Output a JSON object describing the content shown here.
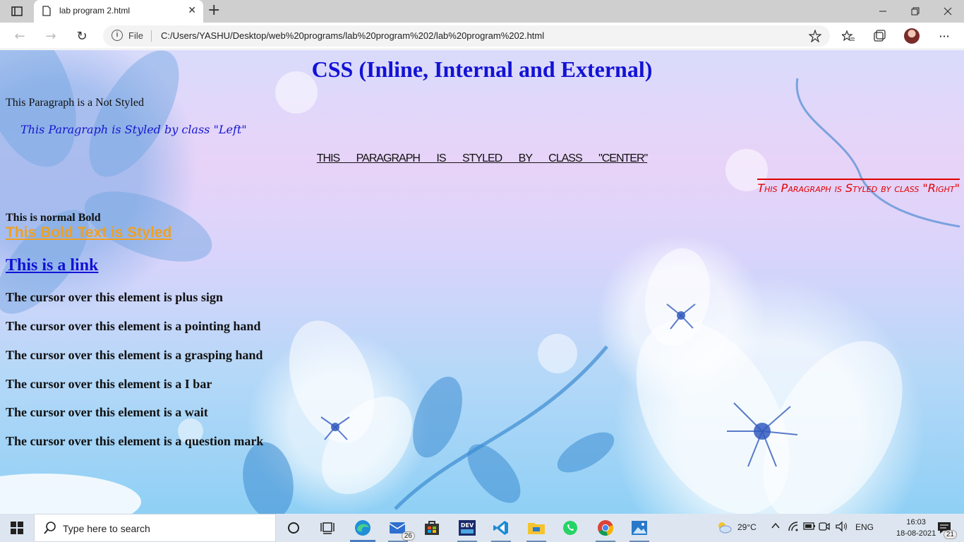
{
  "browser": {
    "tab_title": "lab program 2.html",
    "new_tab_label": "+",
    "close_tab_label": "✕",
    "address_prefix": "File",
    "url": "C:/Users/YASHU/Desktop/web%20programs/lab%20program%202/lab%20program%202.html",
    "window_controls": [
      "minimize-icon",
      "restore-icon",
      "close-icon"
    ]
  },
  "page": {
    "heading": "CSS (Inline, Internal and External)",
    "paragraph_plain": "This Paragraph is a Not Styled",
    "paragraph_left": "This Paragraph is Styled by class \"Left\"",
    "paragraph_center": "This paragraph is styled by class \"center\"",
    "paragraph_right": "This Paragraph is Styled by class \"Right\"",
    "bold_normal": "This is normal Bold",
    "bold_styled": "This Bold Text is Styled",
    "link": "This is a link",
    "cursor_items": [
      "The cursor over this element is plus sign",
      "The cursor over this element is a pointing hand",
      "The cursor over this element is a grasping hand",
      "The cursor over this element is a I bar",
      "The cursor over this element is a wait",
      "The cursor over this element is a question mark"
    ]
  },
  "taskbar": {
    "search_placeholder": "Type here to search",
    "mail_badge": "26",
    "weather": "29°C",
    "language": "ENG",
    "time": "16:03",
    "date": "18-08-2021",
    "notification_count": "21"
  }
}
